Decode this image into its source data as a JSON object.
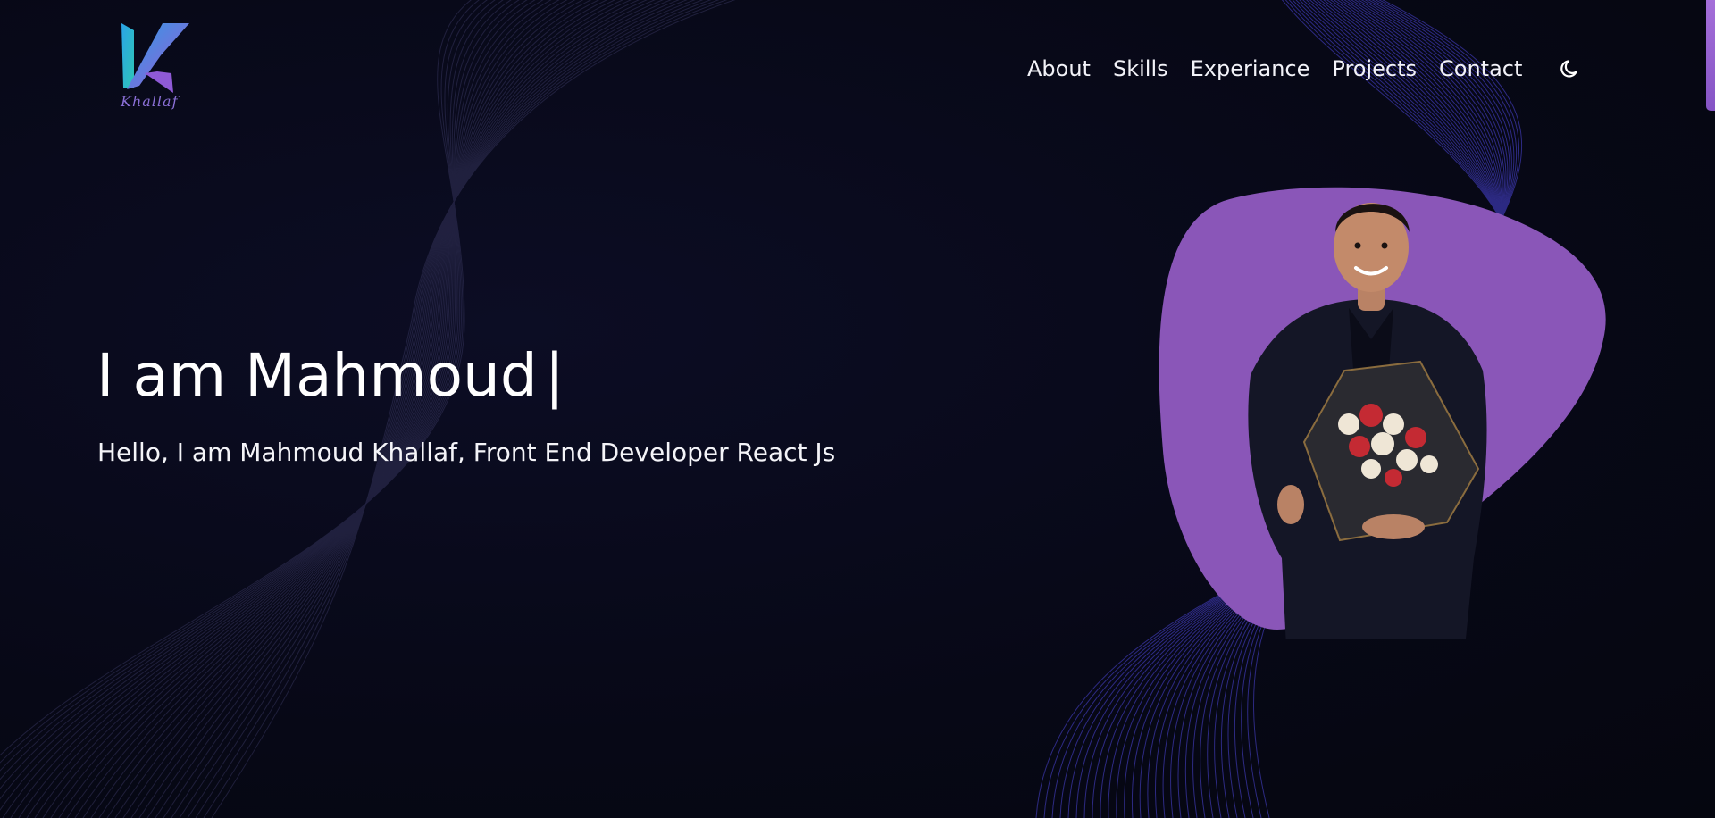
{
  "brand": {
    "logo_icon": "k-letter-logo",
    "logo_text": "Khallaf"
  },
  "nav": {
    "items": [
      {
        "label": "About"
      },
      {
        "label": "Skills"
      },
      {
        "label": "Experiance"
      },
      {
        "label": "Projects"
      },
      {
        "label": "Contact"
      }
    ],
    "theme_icon": "moon-icon"
  },
  "hero": {
    "title": "I am Mahmoud",
    "cursor": "|",
    "subtitle": "Hello, I am Mahmoud Khallaf, Front End Developer React Js"
  },
  "portrait": {
    "blob_color": "#8a56b8",
    "icon": "person-with-bouquet"
  },
  "colors": {
    "background": "#070816",
    "accent": "#8a56b8",
    "lines": "#2b2a6e"
  }
}
